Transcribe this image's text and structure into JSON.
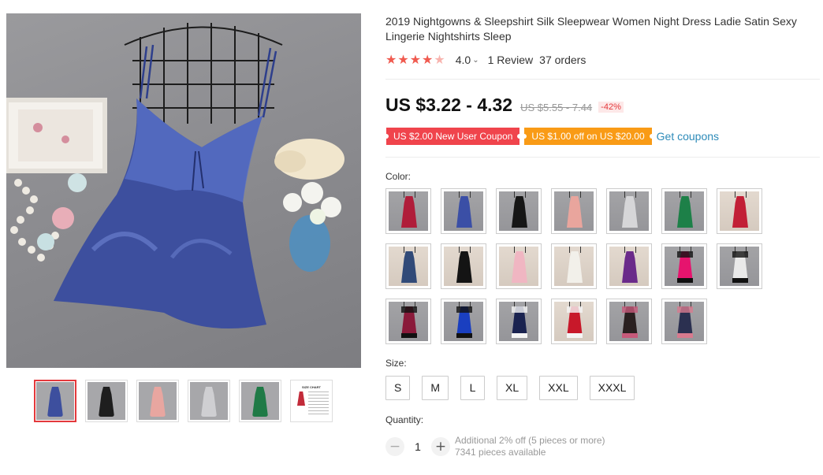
{
  "product": {
    "title": "2019 Nightgowns & Sleepshirt Silk Sleepwear Women Night Dress Ladie Satin Sexy Lingerie Nightshirts Sleep",
    "main_image_color": "#3d4f9e",
    "thumbnails": [
      {
        "color": "#3d4f9e",
        "active": true,
        "icon": "chart-icon"
      },
      {
        "color": "#1e1e1e",
        "active": false
      },
      {
        "color": "#e8a6a0",
        "active": false
      },
      {
        "color": "#cfcfd2",
        "active": false
      },
      {
        "color": "#1f7a46",
        "active": false
      },
      {
        "icon": "size-chart-icon",
        "text": "SIZE CHART",
        "active": false
      }
    ]
  },
  "rating": {
    "stars": 4.0,
    "value": "4.0",
    "reviews": "1 Review",
    "orders": "37 orders"
  },
  "price": {
    "current": "US $3.22 - 4.32",
    "original": "US $5.55 - 7.44",
    "discount": "-42%"
  },
  "coupons": {
    "items": [
      {
        "label": "US $2.00 New User Coupon",
        "color": "#f0444c"
      },
      {
        "label": "US $1.00 off on US $20.00",
        "color": "#f99b16"
      }
    ],
    "get_label": "Get coupons"
  },
  "color": {
    "label": "Color:",
    "swatches": [
      {
        "name": "wine-red",
        "color": "#b01d3a",
        "bg": "gray"
      },
      {
        "name": "royal-blue",
        "color": "#3b4fa6",
        "bg": "gray"
      },
      {
        "name": "black",
        "color": "#161616",
        "bg": "gray"
      },
      {
        "name": "pink",
        "color": "#e9a59d",
        "bg": "gray"
      },
      {
        "name": "silver",
        "color": "#d6d6d8",
        "bg": "gray"
      },
      {
        "name": "green",
        "color": "#1d8048",
        "bg": "gray"
      },
      {
        "name": "red",
        "color": "#c21f36",
        "bg": "light"
      },
      {
        "name": "navy-blue",
        "color": "#314a78",
        "bg": "light"
      },
      {
        "name": "black-2",
        "color": "#141414",
        "bg": "light"
      },
      {
        "name": "light-pink",
        "color": "#f0b6c2",
        "bg": "light"
      },
      {
        "name": "white",
        "color": "#f2f0ea",
        "bg": "light"
      },
      {
        "name": "purple",
        "color": "#6a2a8a",
        "bg": "light"
      },
      {
        "name": "rose-black-lace",
        "color": "#e6146e",
        "bg": "gray",
        "lace": "#111111"
      },
      {
        "name": "white-black-lace",
        "color": "#e9e9e9",
        "bg": "gray",
        "lace": "#111111"
      },
      {
        "name": "burgundy-black-lace",
        "color": "#8a1a3a",
        "bg": "gray",
        "lace": "#111111"
      },
      {
        "name": "blue-black-lace",
        "color": "#1a3fc0",
        "bg": "gray",
        "lace": "#111111"
      },
      {
        "name": "navy-white-lace",
        "color": "#1a2350",
        "bg": "gray",
        "lace": "#f5f5f5"
      },
      {
        "name": "red-white-lace",
        "color": "#c8182a",
        "bg": "light",
        "lace": "#f5f5f5"
      },
      {
        "name": "floral-black",
        "color": "#2a2020",
        "bg": "gray",
        "lace": "#c65a7a"
      },
      {
        "name": "floral-navy",
        "color": "#2b3050",
        "bg": "gray",
        "lace": "#d77a8e"
      }
    ]
  },
  "size": {
    "label": "Size:",
    "options": [
      "S",
      "M",
      "L",
      "XL",
      "XXL",
      "XXXL"
    ]
  },
  "quantity": {
    "label": "Quantity:",
    "value": "1",
    "minus": "−",
    "plus": "+",
    "discount_note": "Additional 2% off (5 pieces or more)",
    "available": "7341 pieces available"
  }
}
